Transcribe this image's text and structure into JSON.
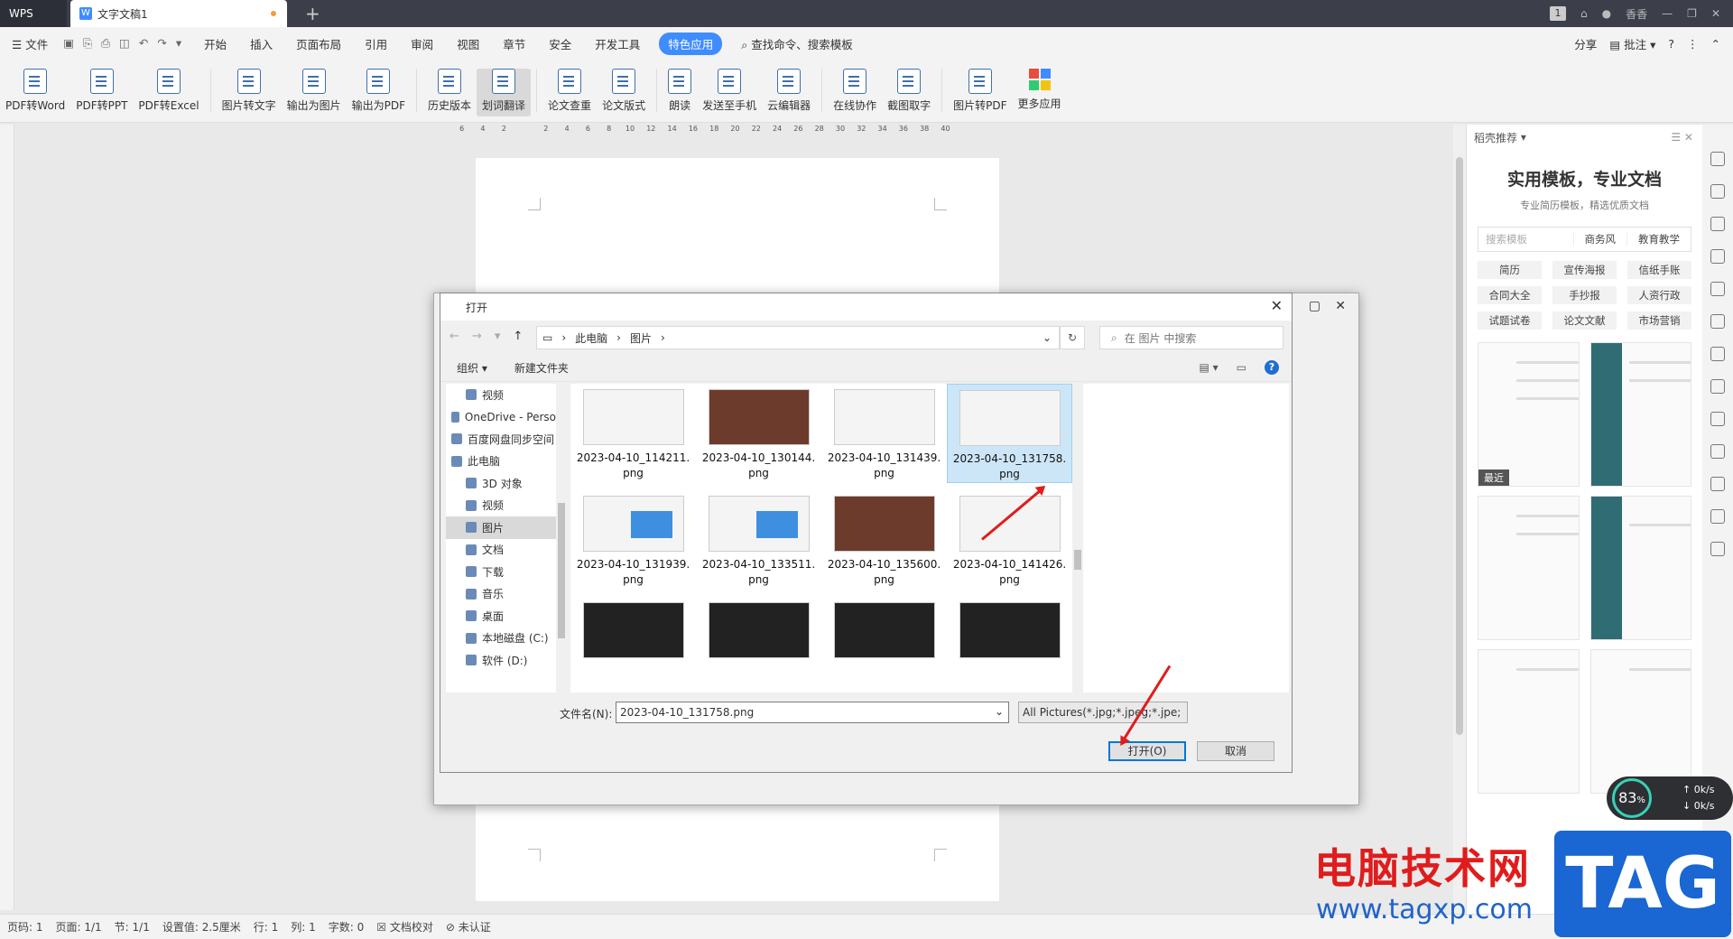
{
  "tabs": {
    "app": "WPS",
    "doc": "文字文稿1",
    "user": "香香"
  },
  "menu": {
    "file": "文件",
    "items": [
      "开始",
      "插入",
      "页面布局",
      "引用",
      "审阅",
      "视图",
      "章节",
      "安全",
      "开发工具"
    ],
    "active": "特色应用",
    "search": "查找命令、搜索模板",
    "share": "分享",
    "annotate": "批注",
    "help": "?"
  },
  "toolbar": [
    {
      "label": "PDF转Word"
    },
    {
      "label": "PDF转PPT"
    },
    {
      "label": "PDF转Excel"
    },
    {
      "label": "图片转文字"
    },
    {
      "label": "输出为图片"
    },
    {
      "label": "输出为PDF"
    },
    {
      "label": "历史版本"
    },
    {
      "label": "划词翻译",
      "selected": true
    },
    {
      "label": "论文查重"
    },
    {
      "label": "论文版式"
    },
    {
      "label": "朗读"
    },
    {
      "label": "发送至手机"
    },
    {
      "label": "云编辑器"
    },
    {
      "label": "在线协作"
    },
    {
      "label": "截图取字"
    },
    {
      "label": "图片转PDF"
    },
    {
      "label": "更多应用"
    }
  ],
  "ruler_labels": [
    "6",
    "4",
    "2",
    "",
    "2",
    "4",
    "6",
    "8",
    "10",
    "12",
    "14",
    "16",
    "18",
    "20",
    "22",
    "24",
    "26",
    "28",
    "30",
    "32",
    "34",
    "36",
    "38",
    "40"
  ],
  "right_panel": {
    "header": "稻壳推荐",
    "title": "实用模板，专业文档",
    "subtitle": "专业简历模板，精选优质文档",
    "search_placeholder": "搜索模板",
    "search_tabs": [
      "商务风",
      "教育教学"
    ],
    "tags": [
      "简历",
      "宣传海报",
      "信纸手账",
      "合同大全",
      "手抄报",
      "人资行政",
      "试题试卷",
      "论文文献",
      "市场营销"
    ],
    "recent": "最近"
  },
  "dialog": {
    "title": "打开",
    "path": [
      "此电脑",
      "图片"
    ],
    "search": "在 图片 中搜索",
    "organize": "组织",
    "new_folder": "新建文件夹",
    "nav": [
      {
        "label": "视频",
        "level": 1
      },
      {
        "label": "OneDrive - Perso",
        "level": 0
      },
      {
        "label": "百度网盘同步空间",
        "level": 0
      },
      {
        "label": "此电脑",
        "level": 0
      },
      {
        "label": "3D 对象",
        "level": 1
      },
      {
        "label": "视频",
        "level": 1
      },
      {
        "label": "图片",
        "level": 1,
        "selected": true
      },
      {
        "label": "文档",
        "level": 1
      },
      {
        "label": "下载",
        "level": 1
      },
      {
        "label": "音乐",
        "level": 1
      },
      {
        "label": "桌面",
        "level": 1
      },
      {
        "label": "本地磁盘 (C:)",
        "level": 1
      },
      {
        "label": "软件 (D:)",
        "level": 1
      }
    ],
    "files": [
      {
        "name": "2023-04-10_114211.",
        "ext": "png",
        "kind": "light"
      },
      {
        "name": "2023-04-10_130144.",
        "ext": "png",
        "kind": "photo"
      },
      {
        "name": "2023-04-10_131439.",
        "ext": "png",
        "kind": "light"
      },
      {
        "name": "2023-04-10_131758.",
        "ext": "png",
        "kind": "light",
        "selected": true
      },
      {
        "name": "2023-04-10_131939.",
        "ext": "png",
        "kind": "blue"
      },
      {
        "name": "2023-04-10_133511.",
        "ext": "png",
        "kind": "blue"
      },
      {
        "name": "2023-04-10_135600.",
        "ext": "png",
        "kind": "photo"
      },
      {
        "name": "2023-04-10_141426.",
        "ext": "png",
        "kind": "light"
      },
      {
        "name": "",
        "ext": "",
        "kind": "dark"
      },
      {
        "name": "",
        "ext": "",
        "kind": "dark"
      },
      {
        "name": "",
        "ext": "",
        "kind": "dark"
      },
      {
        "name": "",
        "ext": "",
        "kind": "dark"
      }
    ],
    "filename_label": "文件名(N):",
    "filename_value": "2023-04-10_131758.png",
    "filetype": "All Pictures(*.jpg;*.jpeg;*.jpe;",
    "open": "打开(O)",
    "cancel": "取消"
  },
  "status": {
    "page": "页码: 1",
    "pages": "页面: 1/1",
    "section": "节: 1/1",
    "setting": "设置值: 2.5厘米",
    "row": "行: 1",
    "col": "列: 1",
    "words": "字数: 0",
    "proof": "文档校对",
    "cert": "未认证"
  },
  "watermark": {
    "cn": "电脑技术网",
    "url": "www.tagxp.com",
    "tag": "TAG"
  },
  "perf": {
    "pct": "83",
    "unit": "%",
    "up": "0k/s",
    "down": "0k/s"
  }
}
